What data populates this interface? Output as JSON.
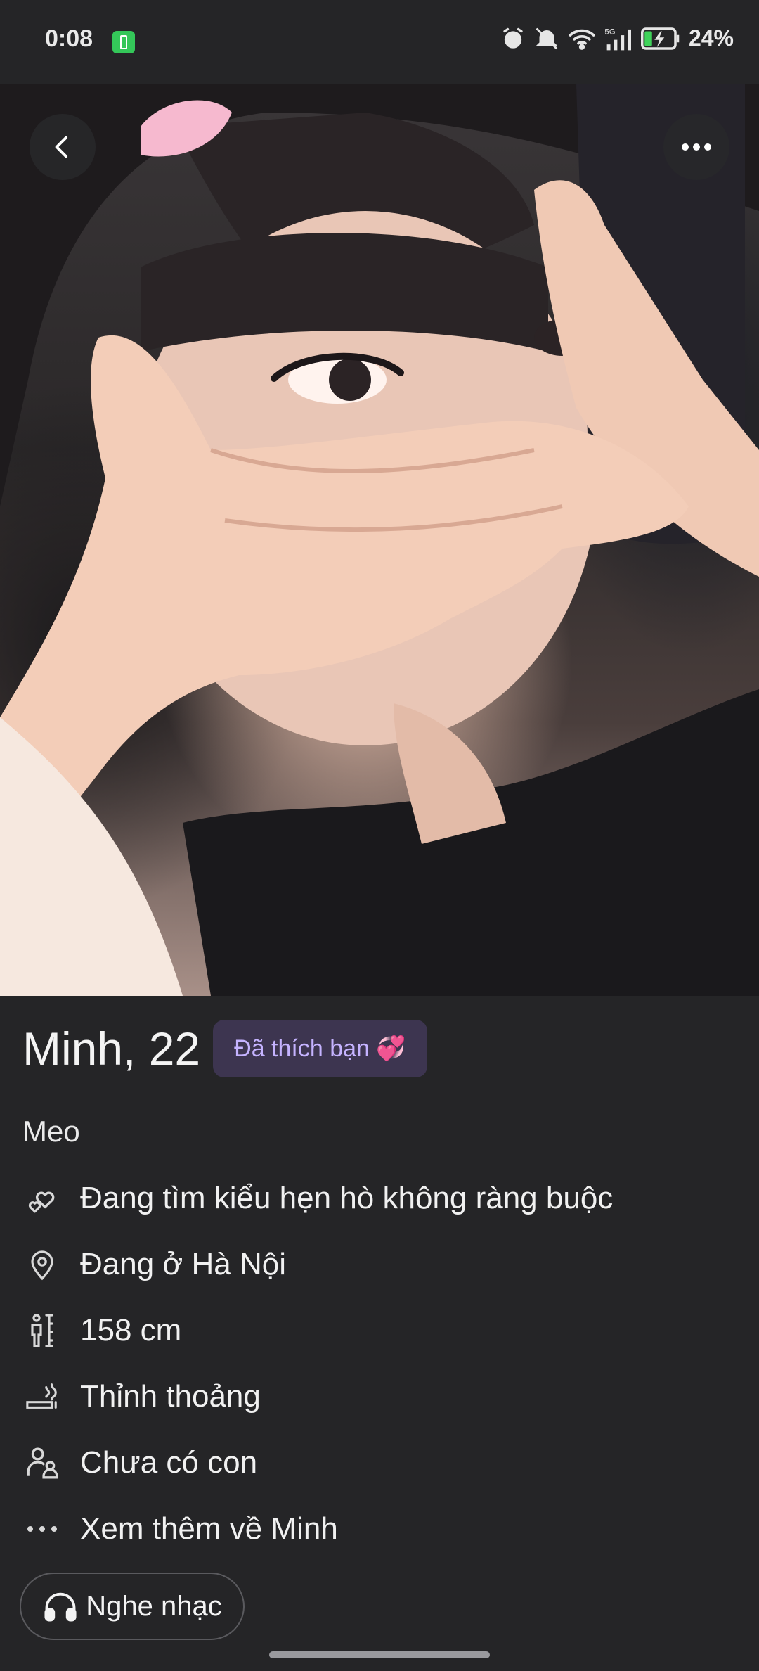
{
  "status_bar": {
    "time": "0:08",
    "battery_percent": "24%",
    "icons": [
      "battery-app-icon",
      "alarm-icon",
      "mute-icon",
      "wifi-icon",
      "signal-5g-icon",
      "battery-charging-icon"
    ]
  },
  "header": {
    "back_icon": "chevron-left-icon",
    "more_icon": "more-horizontal-icon"
  },
  "profile": {
    "name_age": "Minh, 22",
    "liked_badge": "Đã thích bạn 💞",
    "bio": "Meo",
    "details": [
      {
        "icon": "hearts-icon",
        "text": "Đang tìm kiểu hẹn hò không ràng buộc"
      },
      {
        "icon": "location-pin-icon",
        "text": "Đang ở Hà Nội"
      },
      {
        "icon": "height-icon",
        "text": "158 cm"
      },
      {
        "icon": "smoking-icon",
        "text": "Thỉnh thoảng"
      },
      {
        "icon": "family-icon",
        "text": "Chưa có con"
      },
      {
        "icon": "more-dots-icon",
        "text": "Xem thêm về Minh"
      }
    ]
  },
  "music_button": {
    "icon": "headphones-icon",
    "label": "Nghe nhạc"
  },
  "colors": {
    "background": "#252527",
    "badge_bg": "#3d3550",
    "badge_text": "#c5b3ff",
    "text": "#f2f2f2"
  }
}
